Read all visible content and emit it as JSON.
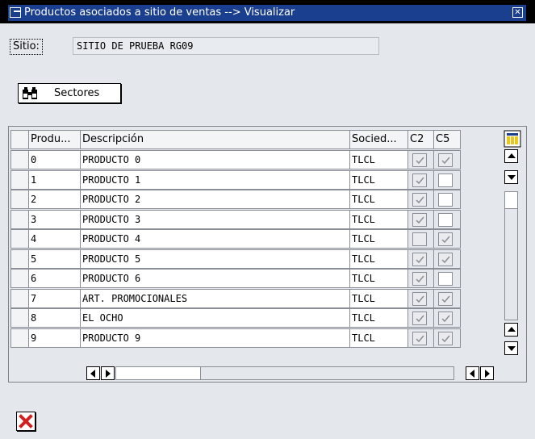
{
  "window": {
    "title": "Productos asociados a sitio de ventas --> Visualizar"
  },
  "form": {
    "sitio_label": "Sitio:",
    "sitio_value": "SITIO DE PRUEBA RG09"
  },
  "toolbar": {
    "sectores_label": "Sectores"
  },
  "table": {
    "columns": [
      "Produ...",
      "Descripción",
      "Socied...",
      "C2",
      "C5"
    ],
    "rows": [
      {
        "prod": "0",
        "desc": "PRODUCTO 0",
        "soc": "TLCL",
        "c2": true,
        "c5": true
      },
      {
        "prod": "1",
        "desc": "PRODUCTO 1",
        "soc": "TLCL",
        "c2": true,
        "c5": false
      },
      {
        "prod": "2",
        "desc": "PRODUCTO 2",
        "soc": "TLCL",
        "c2": true,
        "c5": false
      },
      {
        "prod": "3",
        "desc": "PRODUCTO 3",
        "soc": "TLCL",
        "c2": true,
        "c5": false
      },
      {
        "prod": "4",
        "desc": "PRODUCTO 4",
        "soc": "TLCL",
        "c2": false,
        "c5": true
      },
      {
        "prod": "5",
        "desc": "PRODUCTO 5",
        "soc": "TLCL",
        "c2": true,
        "c5": true
      },
      {
        "prod": "6",
        "desc": "PRODUCTO 6",
        "soc": "TLCL",
        "c2": true,
        "c5": false
      },
      {
        "prod": "7",
        "desc": "ART. PROMOCIONALES",
        "soc": "TLCL",
        "c2": true,
        "c5": true
      },
      {
        "prod": "8",
        "desc": "EL OCHO",
        "soc": "TLCL",
        "c2": true,
        "c5": true
      },
      {
        "prod": "9",
        "desc": "PRODUCTO 9",
        "soc": "TLCL",
        "c2": true,
        "c5": true
      }
    ]
  },
  "icons": {
    "title": "window-icon",
    "close": "close-icon",
    "sectores": "binoculars-icon",
    "layout": "column-layout-icon",
    "cancel": "cancel-icon",
    "scroll_up": "scroll-up-icon",
    "scroll_down": "scroll-down-icon",
    "scroll_left": "scroll-left-icon",
    "scroll_right": "scroll-right-icon"
  },
  "colors": {
    "titlebar": "#1b3f8f",
    "background": "#e4e7ec",
    "cancel": "#d21f1f"
  }
}
